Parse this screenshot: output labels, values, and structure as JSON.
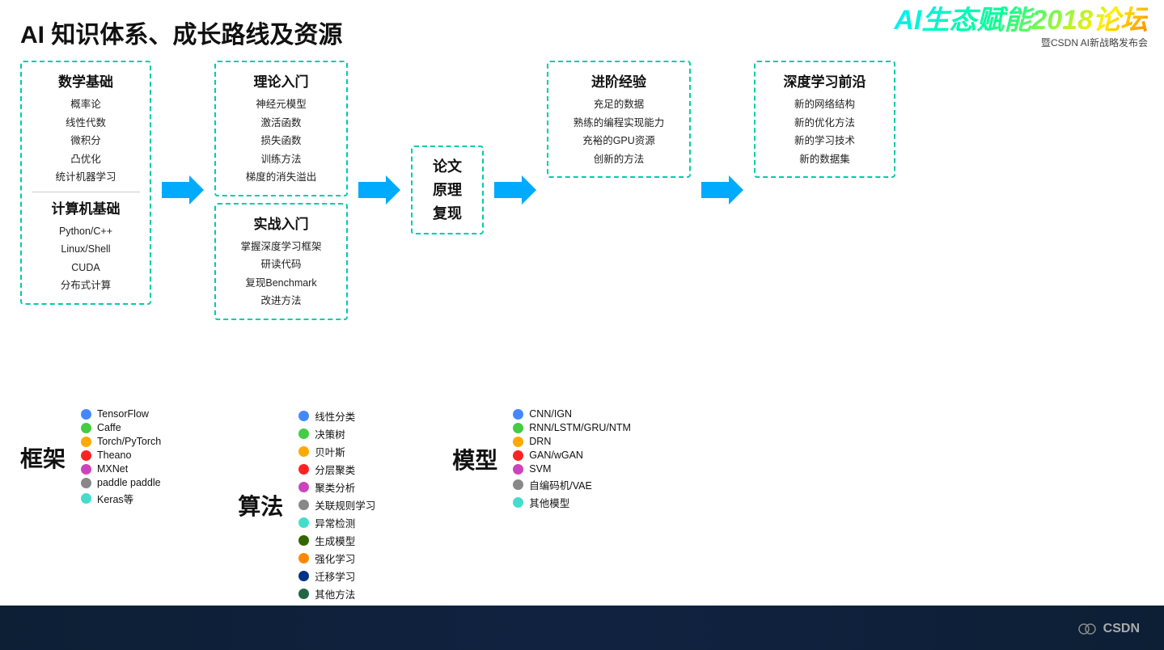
{
  "title": "AI 知识体系、成长路线及资源",
  "forum": {
    "main": "AI生态赋能2018论坛",
    "sub": "暨CSDN AI新战略发布会"
  },
  "flow": {
    "left_block": {
      "title1": "数学基础",
      "items1": [
        "概率论",
        "线性代数",
        "微积分",
        "凸优化",
        "统计机器学习"
      ],
      "title2": "计算机基础",
      "items2": [
        "Python/C++",
        "Linux/Shell",
        "CUDA",
        "分布式计算"
      ]
    },
    "theory_box": {
      "title": "理论入门",
      "items": [
        "神经元模型",
        "激活函数",
        "损失函数",
        "训练方法",
        "梯度的消失溢出"
      ]
    },
    "practical_box": {
      "title": "实战入门",
      "items": [
        "掌握深度学习框架",
        "研读代码",
        "复现Benchmark",
        "改进方法"
      ]
    },
    "paper_box": {
      "text": "论文\n原理\n复现"
    },
    "advance_box": {
      "title": "进阶经验",
      "items": [
        "充足的数据",
        "熟练的编程实现能力",
        "充裕的GPU资源",
        "创新的方法"
      ]
    },
    "deep_box": {
      "title": "深度学习前沿",
      "items": [
        "新的网络结构",
        "新的优化方法",
        "新的学习技术",
        "新的数据集"
      ]
    }
  },
  "legends": {
    "frameworks": {
      "title": "框架",
      "items": [
        {
          "color": "#4488ff",
          "label": "TensorFlow"
        },
        {
          "color": "#44cc44",
          "label": "Caffe"
        },
        {
          "color": "#ffaa00",
          "label": "Torch/PyTorch"
        },
        {
          "color": "#ff2222",
          "label": "Theano"
        },
        {
          "color": "#cc44bb",
          "label": "MXNet"
        },
        {
          "color": "#888888",
          "label": "paddle paddle"
        },
        {
          "color": "#44ddcc",
          "label": "Keras等"
        }
      ]
    },
    "algorithms": {
      "title": "算法",
      "items": [
        {
          "color": "#4488ff",
          "label": "线性分类"
        },
        {
          "color": "#44cc44",
          "label": "决策树"
        },
        {
          "color": "#ffaa00",
          "label": "贝叶斯"
        },
        {
          "color": "#ff2222",
          "label": "分层聚类"
        },
        {
          "color": "#cc44bb",
          "label": "聚类分析"
        },
        {
          "color": "#888888",
          "label": "关联规则学习"
        },
        {
          "color": "#44ddcc",
          "label": "异常检测"
        },
        {
          "color": "#336600",
          "label": "生成模型"
        },
        {
          "color": "#ff8800",
          "label": "强化学习"
        },
        {
          "color": "#003388",
          "label": "迁移学习"
        },
        {
          "color": "#226644",
          "label": "其他方法"
        }
      ]
    },
    "models": {
      "title": "模型",
      "items": [
        {
          "color": "#4488ff",
          "label": "CNN/IGN"
        },
        {
          "color": "#44cc44",
          "label": "RNN/LSTM/GRU/NTM"
        },
        {
          "color": "#ffaa00",
          "label": "DRN"
        },
        {
          "color": "#ff2222",
          "label": "GAN/wGAN"
        },
        {
          "color": "#cc44bb",
          "label": "SVM"
        },
        {
          "color": "#888888",
          "label": "自编码机/VAE"
        },
        {
          "color": "#44ddcc",
          "label": "其他模型"
        }
      ]
    }
  },
  "csdn_logo": "🎯 CSDN"
}
